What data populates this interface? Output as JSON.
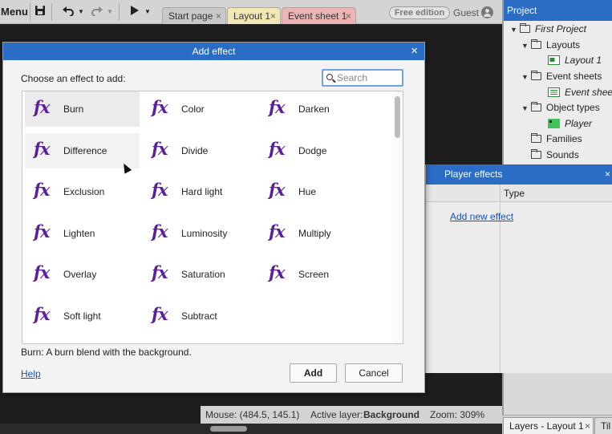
{
  "toolbar": {
    "menu_label": "Menu",
    "tabs": [
      {
        "label": "Start page",
        "close": "×"
      },
      {
        "label": "Layout 1",
        "close": "×"
      },
      {
        "label": "Event sheet 1",
        "close": "×"
      }
    ],
    "edition_badge": "Free edition",
    "user": "Guest"
  },
  "project": {
    "title": "Project",
    "tree": [
      {
        "label": "First Project"
      },
      {
        "label": "Layouts"
      },
      {
        "label": "Layout 1"
      },
      {
        "label": "Event sheets"
      },
      {
        "label": "Event sheet"
      },
      {
        "label": "Object types"
      },
      {
        "label": "Player"
      },
      {
        "label": "Families"
      },
      {
        "label": "Sounds"
      }
    ]
  },
  "player_effects": {
    "title": "Player effects",
    "close": "×",
    "type_header": "Type",
    "add_link": "Add new effect"
  },
  "dialog": {
    "title": "Add effect",
    "close": "×",
    "prompt": "Choose an effect to add:",
    "search_placeholder": "Search",
    "effects": [
      {
        "label": "Burn",
        "selected": true
      },
      {
        "label": "Color"
      },
      {
        "label": "Darken"
      },
      {
        "label": "Difference"
      },
      {
        "label": "Divide"
      },
      {
        "label": "Dodge"
      },
      {
        "label": "Exclusion"
      },
      {
        "label": "Hard light"
      },
      {
        "label": "Hue"
      },
      {
        "label": "Lighten"
      },
      {
        "label": "Luminosity"
      },
      {
        "label": "Multiply"
      },
      {
        "label": "Overlay"
      },
      {
        "label": "Saturation"
      },
      {
        "label": "Screen"
      },
      {
        "label": "Soft light"
      },
      {
        "label": "Subtract"
      }
    ],
    "fx_glyph": "fx",
    "description": "Burn: A burn blend with the background.",
    "help_label": "Help",
    "add_label": "Add",
    "cancel_label": "Cancel"
  },
  "status": {
    "mouse": "Mouse: (484.5, 145.1)",
    "layer_prefix": "Active layer:",
    "layer_name": "Background",
    "zoom": "Zoom: 309%"
  },
  "bottom_tabs": [
    {
      "label": "Layers - Layout 1",
      "close": "×"
    },
    {
      "label": "Til"
    }
  ],
  "colors": {
    "accent": "#2b6cc4",
    "fx_icon": "#5a1f9a",
    "link": "#1c4fb8"
  }
}
